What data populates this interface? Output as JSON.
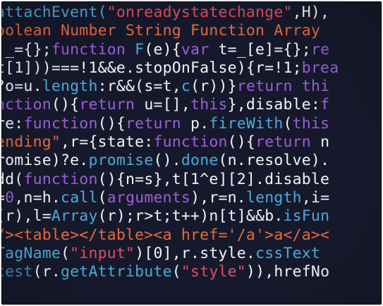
{
  "colors": {
    "background": "#15192b",
    "white": "#f2f2f4",
    "orange": "#e8673a",
    "purple": "#9b5bd6",
    "blue": "#4aa8d8",
    "red": "#e04a5e",
    "dim_blue": "#3b8ab8"
  },
  "lines": [
    [
      {
        "t": "attachEvent(",
        "c": "blue"
      },
      {
        "t": "\"onreadystatechange\"",
        "c": "red"
      },
      {
        "t": ",H),",
        "c": "white"
      }
    ],
    [
      {
        "t": "oolean Number String Function Array",
        "c": "orange"
      }
    ],
    [
      {
        "t": " _={};",
        "c": "white"
      },
      {
        "t": "function ",
        "c": "purple"
      },
      {
        "t": "F",
        "c": "blue"
      },
      {
        "t": "(e){",
        "c": "white"
      },
      {
        "t": "var ",
        "c": "purple"
      },
      {
        "t": "t=_[e]={};",
        "c": "white"
      },
      {
        "t": "re",
        "c": "purple"
      }
    ],
    [
      {
        "t": "t[1]))===!1&&e.stopOnFalse){r=!1;",
        "c": "white"
      },
      {
        "t": "brea",
        "c": "purple"
      }
    ],
    [
      {
        "t": "?o=u.",
        "c": "white"
      },
      {
        "t": "length",
        "c": "blue"
      },
      {
        "t": ":r&&(s=t,",
        "c": "white"
      },
      {
        "t": "c",
        "c": "blue"
      },
      {
        "t": "(r))}",
        "c": "white"
      },
      {
        "t": "return thi",
        "c": "purple"
      }
    ],
    [
      {
        "t": "nction",
        "c": "purple"
      },
      {
        "t": "(){",
        "c": "white"
      },
      {
        "t": "return ",
        "c": "purple"
      },
      {
        "t": "u=[],",
        "c": "white"
      },
      {
        "t": "this",
        "c": "purple"
      },
      {
        "t": "},disable:",
        "c": "white"
      },
      {
        "t": "f",
        "c": "purple"
      }
    ],
    [
      {
        "t": "re:",
        "c": "white"
      },
      {
        "t": "function",
        "c": "purple"
      },
      {
        "t": "(){",
        "c": "white"
      },
      {
        "t": "return ",
        "c": "purple"
      },
      {
        "t": "p.",
        "c": "white"
      },
      {
        "t": "fireWith",
        "c": "blue"
      },
      {
        "t": "(",
        "c": "white"
      },
      {
        "t": "this",
        "c": "purple"
      }
    ],
    [
      {
        "t": "ending\"",
        "c": "orange"
      },
      {
        "t": ",r={state:",
        "c": "white"
      },
      {
        "t": "function",
        "c": "purple"
      },
      {
        "t": "(){",
        "c": "white"
      },
      {
        "t": "return ",
        "c": "purple"
      },
      {
        "t": "n",
        "c": "white"
      }
    ],
    [
      {
        "t": "romise)?e.",
        "c": "white"
      },
      {
        "t": "promise",
        "c": "blue"
      },
      {
        "t": "().",
        "c": "white"
      },
      {
        "t": "done",
        "c": "blue"
      },
      {
        "t": "(n.resolve).",
        "c": "white"
      }
    ],
    [
      {
        "t": "dd(",
        "c": "white"
      },
      {
        "t": "function",
        "c": "purple"
      },
      {
        "t": "(){n=s},t[1^e][2].disable",
        "c": "white"
      }
    ],
    [
      {
        "t": "=",
        "c": "white"
      },
      {
        "t": "0",
        "c": "purple"
      },
      {
        "t": ",n=h.",
        "c": "white"
      },
      {
        "t": "call",
        "c": "blue"
      },
      {
        "t": "(",
        "c": "white"
      },
      {
        "t": "arguments",
        "c": "purple"
      },
      {
        "t": "),r=n.",
        "c": "white"
      },
      {
        "t": "length",
        "c": "blue"
      },
      {
        "t": ",i=",
        "c": "white"
      }
    ],
    [
      {
        "t": "(r),l=",
        "c": "white"
      },
      {
        "t": "Array",
        "c": "blue"
      },
      {
        "t": "(r);r>t;t++)n[t]&&b.",
        "c": "white"
      },
      {
        "t": "isFun",
        "c": "blue"
      }
    ],
    [
      {
        "t": "/><table></table><a href='/a'>a</a><",
        "c": "orange"
      }
    ],
    [
      {
        "t": "TagName",
        "c": "blue"
      },
      {
        "t": "(",
        "c": "white"
      },
      {
        "t": "\"input\"",
        "c": "red"
      },
      {
        "t": ")[0],r.style.",
        "c": "white"
      },
      {
        "t": "cssText",
        "c": "blue"
      }
    ],
    [
      {
        "t": "test",
        "c": "dim_blue"
      },
      {
        "t": "(r.",
        "c": "white"
      },
      {
        "t": "getAttribute",
        "c": "blue"
      },
      {
        "t": "(",
        "c": "white"
      },
      {
        "t": "\"style\"",
        "c": "red"
      },
      {
        "t": ")),hrefNo",
        "c": "white"
      }
    ]
  ]
}
